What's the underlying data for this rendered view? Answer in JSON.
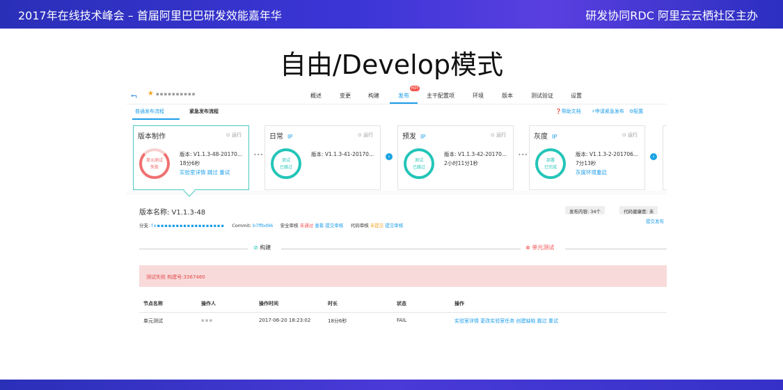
{
  "header": {
    "left_text": "2017年在线技术峰会 – 首届阿里巴巴研发效能嘉年华",
    "right_text": "研发协同RDC 阿里云云栖社区主办"
  },
  "slide_title": "自由/Develop模式",
  "app": {
    "back_icon": "back-icon",
    "project_name": "▪▪▪▪▪▪▪▪▪▪",
    "nav_items": [
      "概述",
      "变更",
      "构建",
      "发布",
      "主干配置项",
      "环境",
      "版本",
      "测试验证",
      "设置"
    ],
    "active_nav": "发布",
    "hot_badge": "HOT",
    "sub_tabs": [
      "普通发布流程",
      "紧急发布流程"
    ],
    "sub_links": [
      "帮助文档",
      "申请紧急发布",
      "配置"
    ],
    "stages": [
      {
        "name": "版本制作",
        "ip": "",
        "run": "运行",
        "ring_top": "单元测试",
        "ring_bottom": "失败",
        "status": "fail",
        "version": "版本: V1.1.3-48-20170...",
        "duration": "18分6秒",
        "links": "实验室详情  跳过  重试"
      },
      {
        "name": "日常",
        "ip": "IP",
        "run": "运行",
        "ring_top": "测试",
        "ring_bottom": "已跳过",
        "status": "ok",
        "version": "版本: V1.1.3-41-20170...",
        "duration": "",
        "links": ""
      },
      {
        "name": "预发",
        "ip": "IP",
        "run": "运行",
        "ring_top": "测试",
        "ring_bottom": "已跳过",
        "status": "ok",
        "version": "版本: V1.1.3-42-20170...",
        "duration": "2小时11分1秒",
        "links": ""
      },
      {
        "name": "灰度",
        "ip": "IP",
        "run": "运行",
        "ring_top": "部署",
        "ring_bottom": "已完成",
        "status": "ok",
        "version": "版本: V1.1.3-2-201706...",
        "duration": "7分13秒",
        "links": "灰度环境重启"
      }
    ],
    "detail": {
      "version_name": "版本名称: V1.1.3-48",
      "publish_content": "发布内容: 34个",
      "code_health": "代码健康度: 未",
      "branch_label": "分支:",
      "branch_value": "fe▪▪▪▪▪▪▪▪▪▪▪▪▪▪▪▪▪▪",
      "commit_label": "Commit:",
      "commit_value": "b7ffbd96",
      "security_label": "安全审核",
      "security_status": "未通过",
      "security_links": "查看  提交审核",
      "code_review_label": "代码审核",
      "code_review_status": "未提交",
      "code_review_link": "提交审核",
      "submit_link": "提交发布",
      "step_build": "构建",
      "step_unit_test": "单元测试",
      "error_text": "测试失败 构建号:3367460",
      "table_headers": [
        "节点名称",
        "操作人",
        "操作时间",
        "时长",
        "状态",
        "操作"
      ],
      "row": {
        "node": "单元测试",
        "operator": "▪▪▪",
        "time": "2017-06-20 18:23:02",
        "duration": "18分6秒",
        "status": "FAIL",
        "ops": "实验室详情  更改实验室任务  创建缺陷  跳过  重试"
      }
    }
  }
}
